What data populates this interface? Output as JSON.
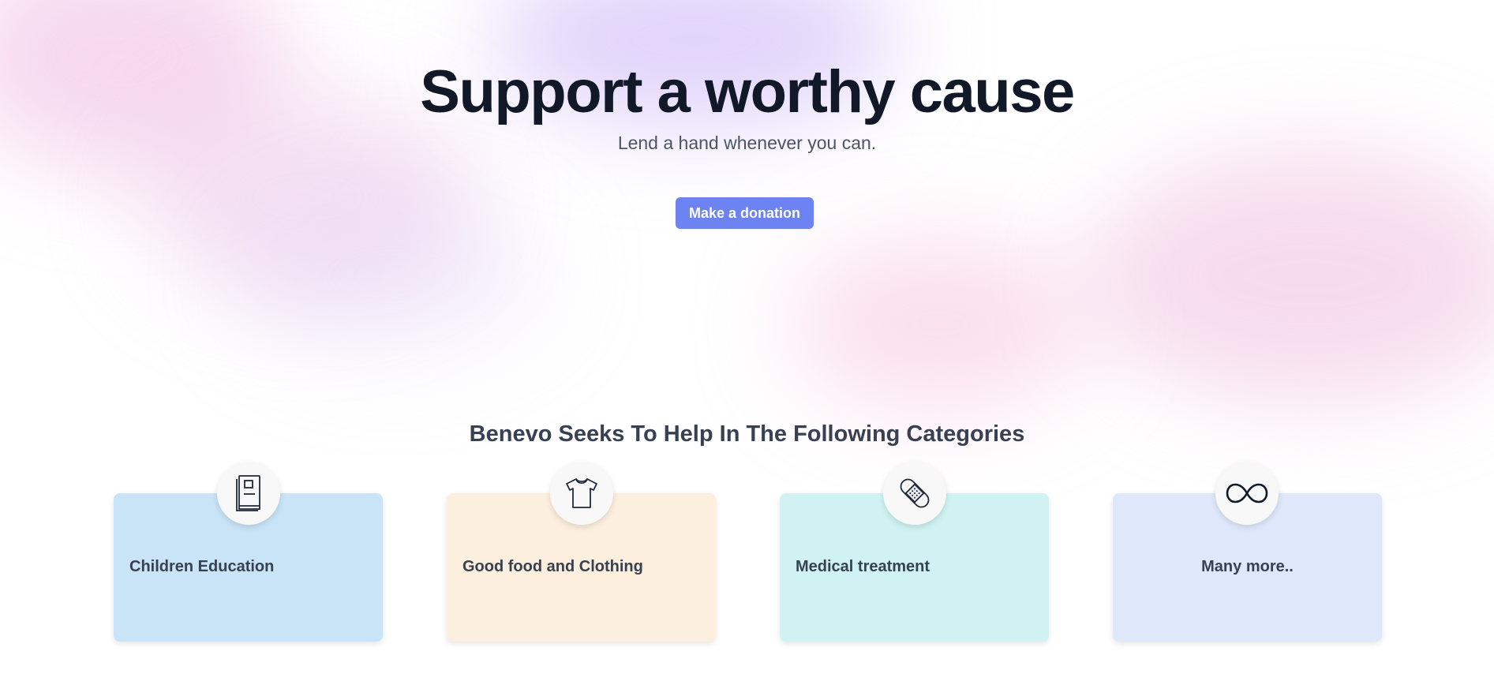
{
  "hero": {
    "title": "Support a worthy cause",
    "subtitle": "Lend a hand whenever you can.",
    "cta_label": "Make a donation"
  },
  "categories": {
    "heading": "Benevo Seeks To Help In The Following Categories",
    "items": [
      {
        "label": "Children Education",
        "icon": "book-icon",
        "color": "#c9e3f7"
      },
      {
        "label": "Good food and Clothing",
        "icon": "tshirt-icon",
        "color": "#fdefdd"
      },
      {
        "label": "Medical treatment",
        "icon": "bandage-icon",
        "color": "#d0f2f2"
      },
      {
        "label": "Many more..",
        "icon": "infinity-icon",
        "color": "#dfe8fb"
      }
    ]
  },
  "colors": {
    "accent": "#6d83f2",
    "heading_text": "#111827",
    "body_text": "#374151"
  }
}
